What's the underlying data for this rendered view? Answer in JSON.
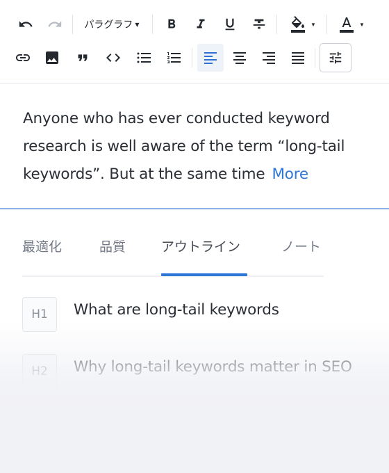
{
  "toolbar": {
    "paragraph_label": "パラグラフ",
    "icons": {
      "undo": "undo-icon",
      "redo": "redo-icon",
      "bold": "bold-icon",
      "italic": "italic-icon",
      "underline": "underline-icon",
      "strikethrough": "strikethrough-icon",
      "highlight": "fill-color-icon",
      "font_color": "font-color-icon",
      "link": "link-icon",
      "image": "image-icon",
      "quote": "quote-icon",
      "code": "code-icon",
      "bulleted_list": "bulleted-list-icon",
      "numbered_list": "numbered-list-icon",
      "align_left": "align-left-icon",
      "align_center": "align-center-icon",
      "align_right": "align-right-icon",
      "justify": "align-justify-icon",
      "settings": "sliders-icon"
    },
    "active_alignment": "left"
  },
  "content": {
    "text": "Anyone who has ever conducted keyword research is well aware of the term “long-tail keywords”. But at the same time",
    "more_label": "More"
  },
  "tabs": [
    {
      "label": "最適化",
      "active": false
    },
    {
      "label": "品質",
      "active": false
    },
    {
      "label": "アウトライン",
      "active": true
    },
    {
      "label": "ノート",
      "active": false
    }
  ],
  "outline": [
    {
      "level": "H1",
      "text": "What are long-tail keywords"
    },
    {
      "level": "H2",
      "text": "Why long-tail keywords matter in SEO"
    }
  ],
  "colors": {
    "accent": "#2d77d6",
    "text": "#2a2e35",
    "muted": "#737985",
    "fade": "#f1f2f6"
  }
}
